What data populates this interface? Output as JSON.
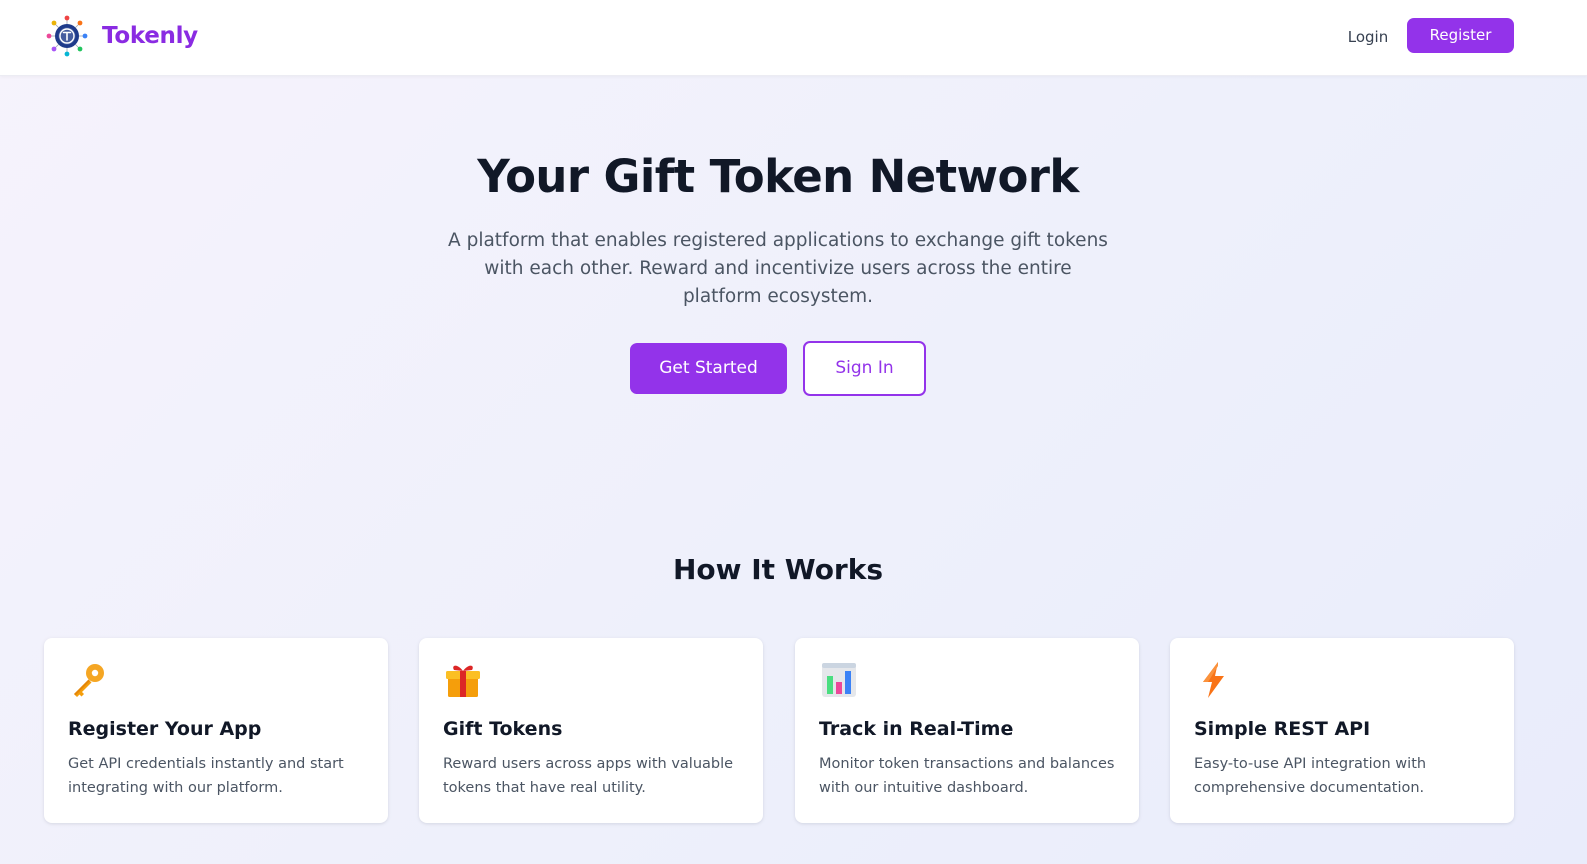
{
  "header": {
    "brand": "Tokenly",
    "logo_icon": "tokenly-logo-icon",
    "login_label": "Login",
    "register_label": "Register"
  },
  "hero": {
    "title": "Your Gift Token Network",
    "subtitle": "A platform that enables registered applications to exchange gift tokens with each other. Reward and incentivize users across the entire platform ecosystem.",
    "primary_cta": "Get Started",
    "secondary_cta": "Sign In"
  },
  "how_it_works": {
    "title": "How It Works",
    "cards": [
      {
        "icon": "key-icon",
        "title": "Register Your App",
        "description": "Get API credentials instantly and start integrating with our platform."
      },
      {
        "icon": "gift-icon",
        "title": "Gift Tokens",
        "description": "Reward users across apps with valuable tokens that have real utility."
      },
      {
        "icon": "bar-chart-icon",
        "title": "Track in Real-Time",
        "description": "Monitor token transactions and balances with our intuitive dashboard."
      },
      {
        "icon": "lightning-icon",
        "title": "Simple REST API",
        "description": "Easy-to-use API integration with comprehensive documentation."
      }
    ]
  },
  "colors": {
    "accent": "#9333ea",
    "brand_text": "#8a2be2",
    "heading": "#111827",
    "body_text": "#4b5563"
  }
}
